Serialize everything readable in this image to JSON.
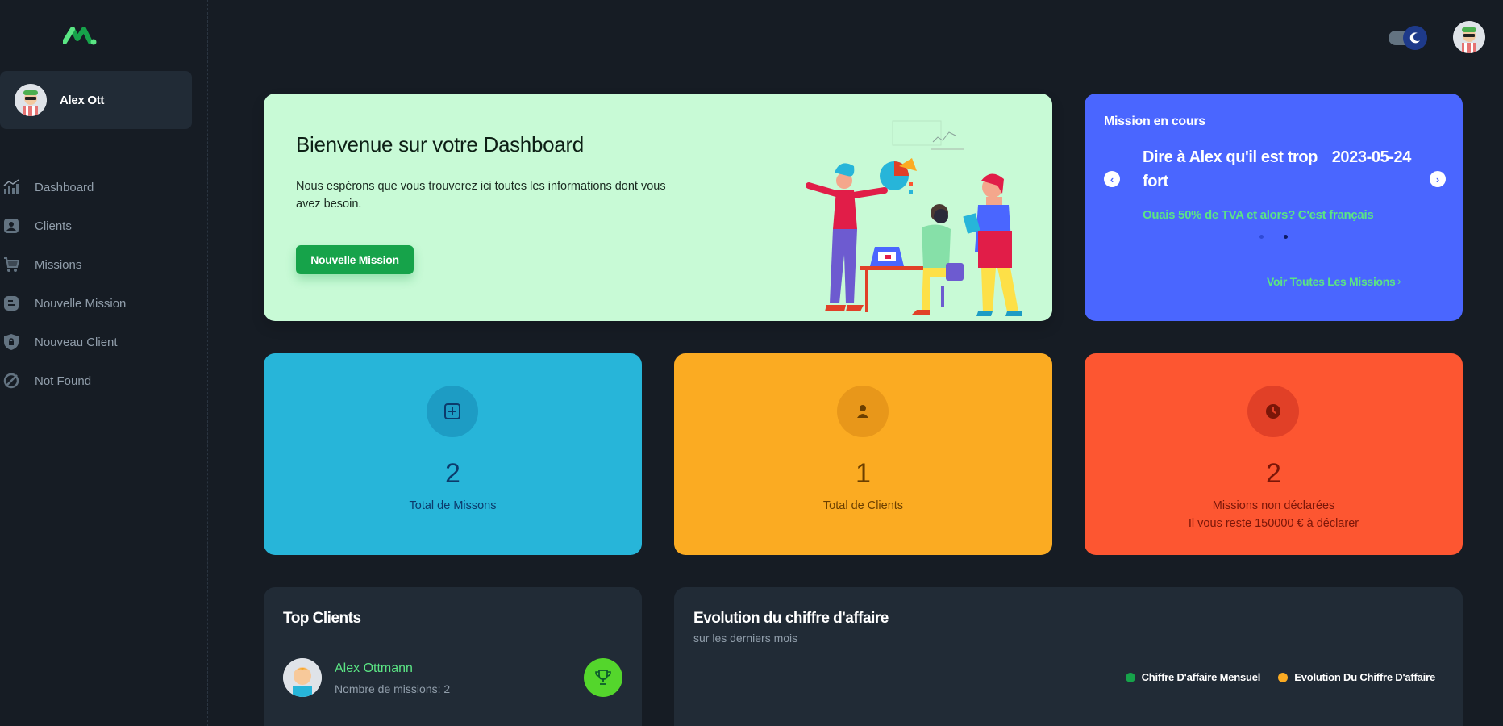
{
  "sidebar": {
    "user_name": "Alex Ott",
    "items": [
      {
        "label": "Dashboard",
        "icon": "chart-icon"
      },
      {
        "label": "Clients",
        "icon": "user-icon"
      },
      {
        "label": "Missions",
        "icon": "cart-icon"
      },
      {
        "label": "Nouvelle Mission",
        "icon": "blog-icon"
      },
      {
        "label": "Nouveau Client",
        "icon": "lock-shield-icon"
      },
      {
        "label": "Not Found",
        "icon": "ban-icon"
      }
    ]
  },
  "header": {
    "theme_toggle": "dark-mode-toggle"
  },
  "welcome": {
    "title": "Bienvenue sur votre Dashboard",
    "text": "Nous espérons que vous trouverez ici toutes les informations dont vous avez besoin.",
    "button": "Nouvelle Mission"
  },
  "mission": {
    "title": "Mission en cours",
    "name": "Dire à Alex qu'il est trop fort",
    "date": "2023-05-24",
    "subtitle": "Ouais 50% de TVA et alors? C'est français",
    "prev": "‹",
    "next": "›",
    "link": "Voir Toutes Les Missions",
    "link_chevron": "›"
  },
  "stats": {
    "missions": {
      "value": "2",
      "label": "Total de Missons"
    },
    "clients": {
      "value": "1",
      "label": "Total de Clients"
    },
    "undeclared": {
      "value": "2",
      "label": "Missions non déclarées",
      "sublabel": "Il vous reste 150000 € à déclarer"
    }
  },
  "top_clients": {
    "title": "Top Clients",
    "client_name": "Alex Ottmann",
    "client_missions": "Nombre de missions: 2"
  },
  "revenue_chart": {
    "title": "Evolution du chiffre d'affaire",
    "subtitle": "sur les derniers mois",
    "legend": [
      {
        "name": "Chiffre D'affaire Mensuel",
        "color": "#16a34a"
      },
      {
        "name": "Evolution Du Chiffre D'affaire",
        "color": "#fbab22"
      }
    ],
    "y_tick": "5"
  },
  "colors": {
    "background": "#161c24",
    "card": "#212b36",
    "welcome": "#c8fad6",
    "mission": "#4a66ff",
    "stat_blue": "#27b5d9",
    "stat_yellow": "#fbab22",
    "stat_red": "#fd5631",
    "accent_green": "#5be584"
  }
}
